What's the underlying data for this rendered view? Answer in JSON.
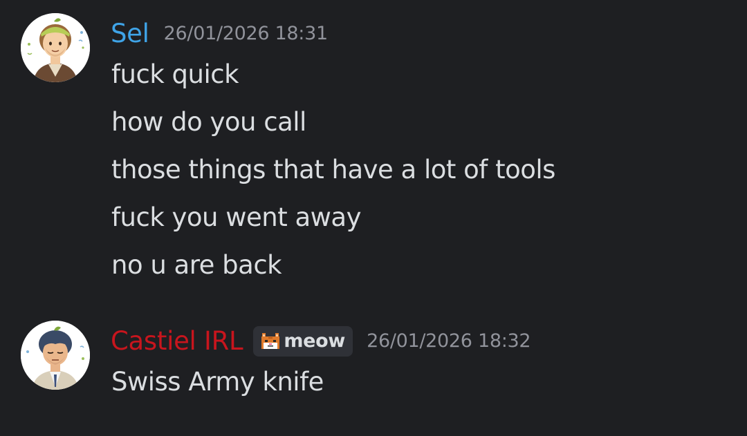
{
  "messages": [
    {
      "author": "Sel",
      "author_color": "#3fa4e8",
      "timestamp": "26/01/2026 18:31",
      "avatar_icon": "avatar-sel",
      "lines": [
        "fuck quick",
        "how do you call",
        "those things that have a lot of tools",
        "fuck you went away",
        "no u are back"
      ]
    },
    {
      "author": "Castiel IRL",
      "author_color": "#c8151d",
      "badge": {
        "icon": "cat-face-icon",
        "label": "meow"
      },
      "timestamp": "26/01/2026 18:32",
      "avatar_icon": "avatar-castiel",
      "lines": [
        "Swiss Army knife"
      ]
    }
  ]
}
